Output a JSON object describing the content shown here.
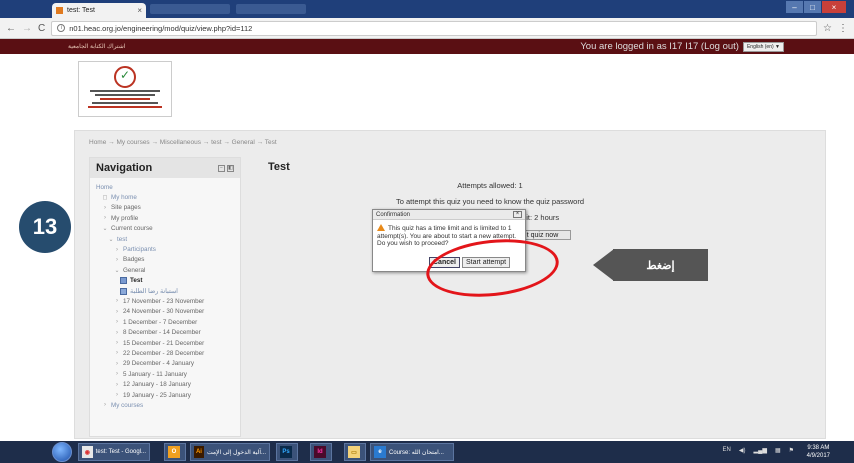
{
  "browser": {
    "tab_title": "test: Test",
    "url": "n01.heac.org.jo/engineering/mod/quiz/view.php?id=112"
  },
  "site": {
    "header_arabic": "اشتراك الكتابة الجامعية",
    "login_text": "You are logged in as I17 I17 (Log out)",
    "language": "English (en) ▼"
  },
  "breadcrumb": "Home → My courses → Miscellaneous → test → General → Test",
  "nav": {
    "title": "Navigation",
    "items": [
      {
        "label": "Home",
        "icon": "",
        "style": "link"
      },
      {
        "label": "My home",
        "icon": "◻",
        "style": "link"
      },
      {
        "label": "Site pages",
        "icon": "›",
        "style": ""
      },
      {
        "label": "My profile",
        "icon": "›",
        "style": ""
      },
      {
        "label": "Current course",
        "icon": "⌄",
        "style": ""
      },
      {
        "label": "test",
        "icon": "⌄",
        "style": "link"
      },
      {
        "label": "Participants",
        "icon": "›",
        "style": "link"
      },
      {
        "label": "Badges",
        "icon": "›",
        "style": ""
      },
      {
        "label": "General",
        "icon": "⌄",
        "style": ""
      },
      {
        "label": "Test",
        "icon": "quiz",
        "style": "bold"
      },
      {
        "label": "استبانة رضا الطلبة",
        "icon": "doc",
        "style": "link"
      },
      {
        "label": "17 November - 23 November",
        "icon": "›",
        "style": ""
      },
      {
        "label": "24 November - 30 November",
        "icon": "›",
        "style": ""
      },
      {
        "label": "1 December - 7 December",
        "icon": "›",
        "style": ""
      },
      {
        "label": "8 December - 14 December",
        "icon": "›",
        "style": ""
      },
      {
        "label": "15 December - 21 December",
        "icon": "›",
        "style": ""
      },
      {
        "label": "22 December - 28 December",
        "icon": "›",
        "style": ""
      },
      {
        "label": "29 December - 4 January",
        "icon": "›",
        "style": ""
      },
      {
        "label": "5 January - 11 January",
        "icon": "›",
        "style": ""
      },
      {
        "label": "12 January - 18 January",
        "icon": "›",
        "style": ""
      },
      {
        "label": "19 January - 25 January",
        "icon": "›",
        "style": ""
      },
      {
        "label": "My courses",
        "icon": "›",
        "style": "link"
      }
    ]
  },
  "main": {
    "title": "Test",
    "attempts": "Attempts allowed: 1",
    "password_note": "To attempt this quiz you need to know the quiz password",
    "time_limit": "mit: 2 hours",
    "attempt_button": "t quiz now"
  },
  "dialog": {
    "title": "Confirmation",
    "message": "This quiz has a time limit and is limited to 1 attempt(s). You are about to start a new attempt. Do you wish to proceed?",
    "cancel": "Cancel",
    "start": "Start attempt"
  },
  "annotation": {
    "step_number": "13",
    "callout": "إضغط",
    "ring_color": "#e3151a"
  },
  "taskbar": {
    "items": [
      {
        "label": "test: Test - Googl...",
        "icon": "chrome-icon"
      },
      {
        "label": "",
        "icon": "outlook-icon"
      },
      {
        "label": "آلية الدخول إلى الإمت...",
        "icon": "illustrator-icon"
      },
      {
        "label": "",
        "icon": "photoshop-icon"
      },
      {
        "label": "",
        "icon": "indesign-icon"
      },
      {
        "label": "",
        "icon": "explorer-icon"
      },
      {
        "label": "Course: امتحان الله...",
        "icon": "ie-icon"
      }
    ],
    "lang": "EN",
    "time": "9:38 AM",
    "date": "4/9/2017"
  }
}
